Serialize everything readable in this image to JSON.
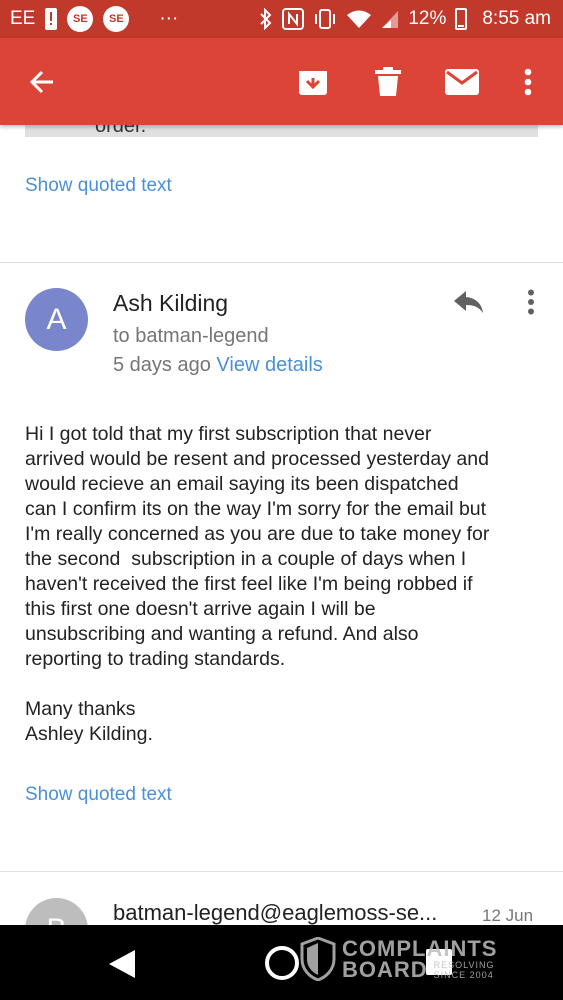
{
  "status_bar": {
    "carrier": "EE",
    "badge1": "SE",
    "badge2": "SE",
    "dots": "···",
    "battery_percent": "12%",
    "battery_level": 0.12,
    "time": "8:55 am"
  },
  "colors": {
    "status_bar": "#c0392b",
    "toolbar": "#db4437",
    "link": "#4a90d9",
    "avatar_a": "#7986cb",
    "avatar_b": "#bdbdbd"
  },
  "previous_message": {
    "tail_text": "order.",
    "show_quoted": "Show quoted text"
  },
  "message": {
    "avatar_letter": "A",
    "sender": "Ash Kilding",
    "to": "to batman-legend",
    "time": "5 days ago",
    "view_details": "View details",
    "body": [
      "Hi I got told that my first subscription that never\narrived would be resent and processed yesterday and\nwould recieve an email saying its been dispatched\ncan I confirm its on the way I'm sorry for the email but\nI'm really concerned as you are due to take money for\nthe second  subscription in a couple of days when I\nhaven't received the first feel like I'm being robbed if\nthis first one doesn't arrive again I will be\nunsubscribing and wanting a refund. And also\nreporting to trading standards.",
      "Many thanks\nAshley Kilding."
    ],
    "show_quoted": "Show quoted text"
  },
  "next_message": {
    "avatar_letter": "B",
    "sender": "batman-legend@eaglemoss-se...",
    "date": "12 Jun"
  },
  "watermark": {
    "line1": "COMPLAINTS",
    "line2": "BOARD",
    "tag1": "RESOLVING",
    "tag2": "SINCE 2004"
  }
}
